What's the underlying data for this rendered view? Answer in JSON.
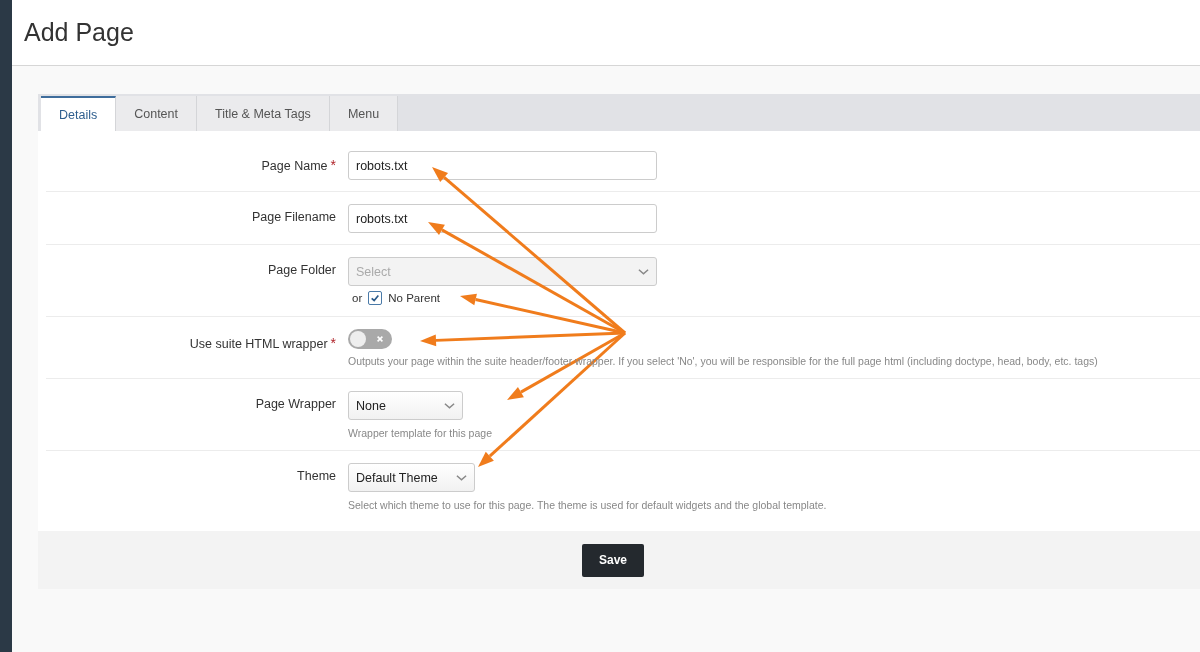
{
  "page": {
    "title": "Add Page"
  },
  "tabs": [
    {
      "label": "Details",
      "selected": true
    },
    {
      "label": "Content",
      "selected": false
    },
    {
      "label": "Title & Meta Tags",
      "selected": false
    },
    {
      "label": "Menu",
      "selected": false
    }
  ],
  "fields": [
    {
      "kind": "text",
      "label": "Page Name",
      "required_mark": "*",
      "value": "robots.txt"
    },
    {
      "kind": "text",
      "label": "Page Filename",
      "value": "robots.txt"
    },
    {
      "kind": "select",
      "label": "Page Folder",
      "placeholder": "Select",
      "disabled": true,
      "or_text": "or",
      "checkbox": {
        "label": "No Parent",
        "checked": true
      }
    },
    {
      "kind": "toggle",
      "label": "Use suite HTML wrapper",
      "required_mark": "*",
      "on": false,
      "help": "Outputs your page within the suite header/footer wrapper. If you select 'No', you will be responsible for the full page html (including doctype, head, body, etc. tags)"
    },
    {
      "kind": "select",
      "label": "Page Wrapper",
      "value": "None",
      "disabled": false,
      "help": "Wrapper template for this page"
    },
    {
      "kind": "select",
      "label": "Theme",
      "value": "Default Theme",
      "disabled": false,
      "help": "Select which theme to use for this page. The theme is used for default widgets and the global template."
    }
  ],
  "save_button": "Save"
}
